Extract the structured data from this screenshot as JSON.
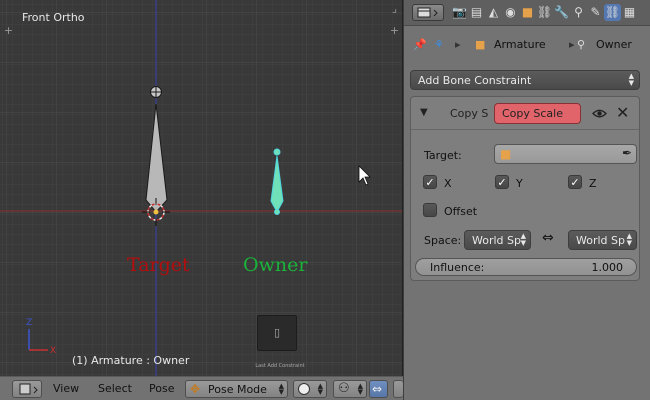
{
  "viewport": {
    "title": "Front Ortho",
    "status": "(1) Armature : Owner",
    "target_label": "Target",
    "owner_label": "Owner",
    "hint_text": "Last Add Constraint"
  },
  "header": {
    "menus": [
      "View",
      "Select",
      "Pose"
    ],
    "mode": "Pose Mode"
  },
  "properties": {
    "tabs": [
      "render-icon",
      "render-layers-icon",
      "scene-icon",
      "world-icon",
      "object-icon",
      "constraints-icon",
      "modifiers-icon",
      "bone-icon",
      "bone-constraint-icon",
      "texture-icon"
    ],
    "context": {
      "object": "Armature",
      "bone": "Owner"
    },
    "add_constraint": "Add Bone Constraint",
    "constraint": {
      "short_label": "Copy S",
      "name": "Copy Scale",
      "target_label": "Target:",
      "x_label": "X",
      "y_label": "Y",
      "z_label": "Z",
      "x_checked": true,
      "y_checked": true,
      "z_checked": true,
      "offset_label": "Offset",
      "offset_checked": false,
      "space_label": "Space:",
      "owner_space": "World Sp",
      "target_space": "World Sp",
      "influence_label": "Influence:",
      "influence_value": "1.000"
    }
  },
  "colors": {
    "target_text": "#b40d0d",
    "owner_text": "#1bb33a",
    "owner_bone": "#6fe0b8",
    "constraint_name_bg": "#e0646a"
  }
}
